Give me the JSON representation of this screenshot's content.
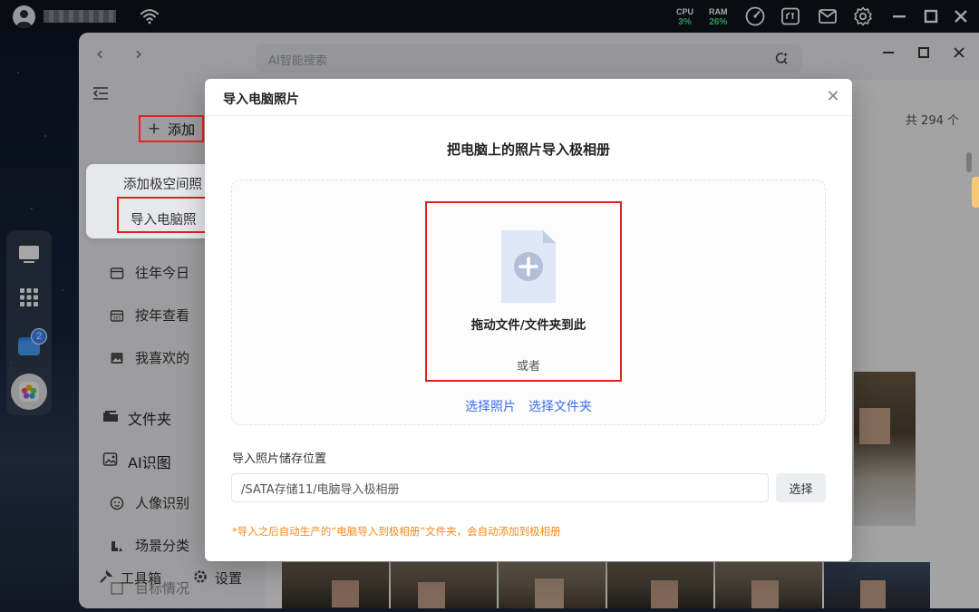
{
  "topbar": {
    "cpu_label": "CPU",
    "cpu_value": "3%",
    "ram_label": "RAM",
    "ram_value": "26%",
    "icons": [
      "user-avatar",
      "wifi-icon",
      "gauge-icon",
      "monitor-icon",
      "mail-icon",
      "gear-icon",
      "minimize-icon",
      "maximize-icon",
      "close-icon"
    ]
  },
  "dock": {
    "badge_count": "2"
  },
  "app": {
    "search_placeholder": "AI智能搜索",
    "add_label": "添加",
    "dropdown": {
      "item1": "添加极空间照",
      "item2": "导入电脑照"
    },
    "sidebar": {
      "item_year_today": "往年今日",
      "item_by_year": "按年查看",
      "item_favorites": "我喜欢的",
      "group_folders": "文件夹",
      "group_ai": "AI识图",
      "item_people": "人像识别",
      "item_scenes": "场景分类",
      "item_more": "目标情况",
      "toolbox": "工具箱",
      "settings": "设置"
    },
    "total_count": "共 294 个"
  },
  "modal": {
    "title": "导入电脑照片",
    "heading": "把电脑上的照片导入极相册",
    "drop_text": "拖动文件/文件夹到此",
    "or_text": "或者",
    "link_photos": "选择照片",
    "link_folder": "选择文件夹",
    "storage_label": "导入照片储存位置",
    "storage_path": "/SATA存储11/电脑导入极相册",
    "choose_button": "选择",
    "note": "*导入之后自动生产的“电脑导入到极相册”文件夹，会自动添加到极相册"
  }
}
